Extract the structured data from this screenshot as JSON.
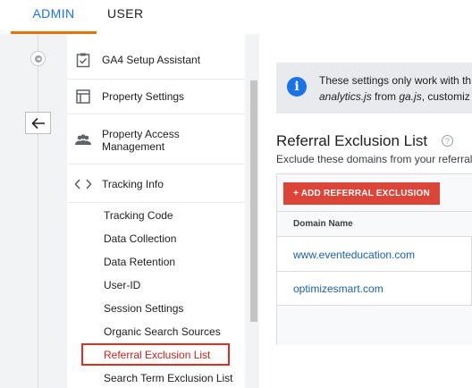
{
  "tabs": {
    "admin": "ADMIN",
    "user": "USER"
  },
  "nav": {
    "items": [
      {
        "label": "GA4 Setup Assistant",
        "icon": "clipboard-check-icon"
      },
      {
        "label": "Property Settings",
        "icon": "layout-icon"
      },
      {
        "label": "Property Access Management",
        "icon": "people-icon"
      },
      {
        "label": "Tracking Info",
        "icon": "code-icon"
      }
    ],
    "sub_items": [
      "Tracking Code",
      "Data Collection",
      "Data Retention",
      "User-ID",
      "Session Settings",
      "Organic Search Sources",
      "Referral Exclusion List",
      "Search Term Exclusion List"
    ],
    "active": "Referral Exclusion List"
  },
  "notice": {
    "line1": "These settings only work with th",
    "line2_code1": "analytics.js",
    "line2_mid": " from ",
    "line2_code2": "ga.js",
    "line2_end": ", customiz"
  },
  "page": {
    "title": "Referral Exclusion List",
    "subtitle": "Exclude these domains from your referral",
    "add_button": "+ ADD REFERRAL EXCLUSION",
    "column_header": "Domain Name",
    "rows": [
      "www.eventeducation.com",
      "optimizesmart.com"
    ]
  },
  "colors": {
    "accent": "#1a73e8",
    "tab_underline": "#e8710a",
    "add_button": "#db4437",
    "highlight": "#d93025"
  }
}
